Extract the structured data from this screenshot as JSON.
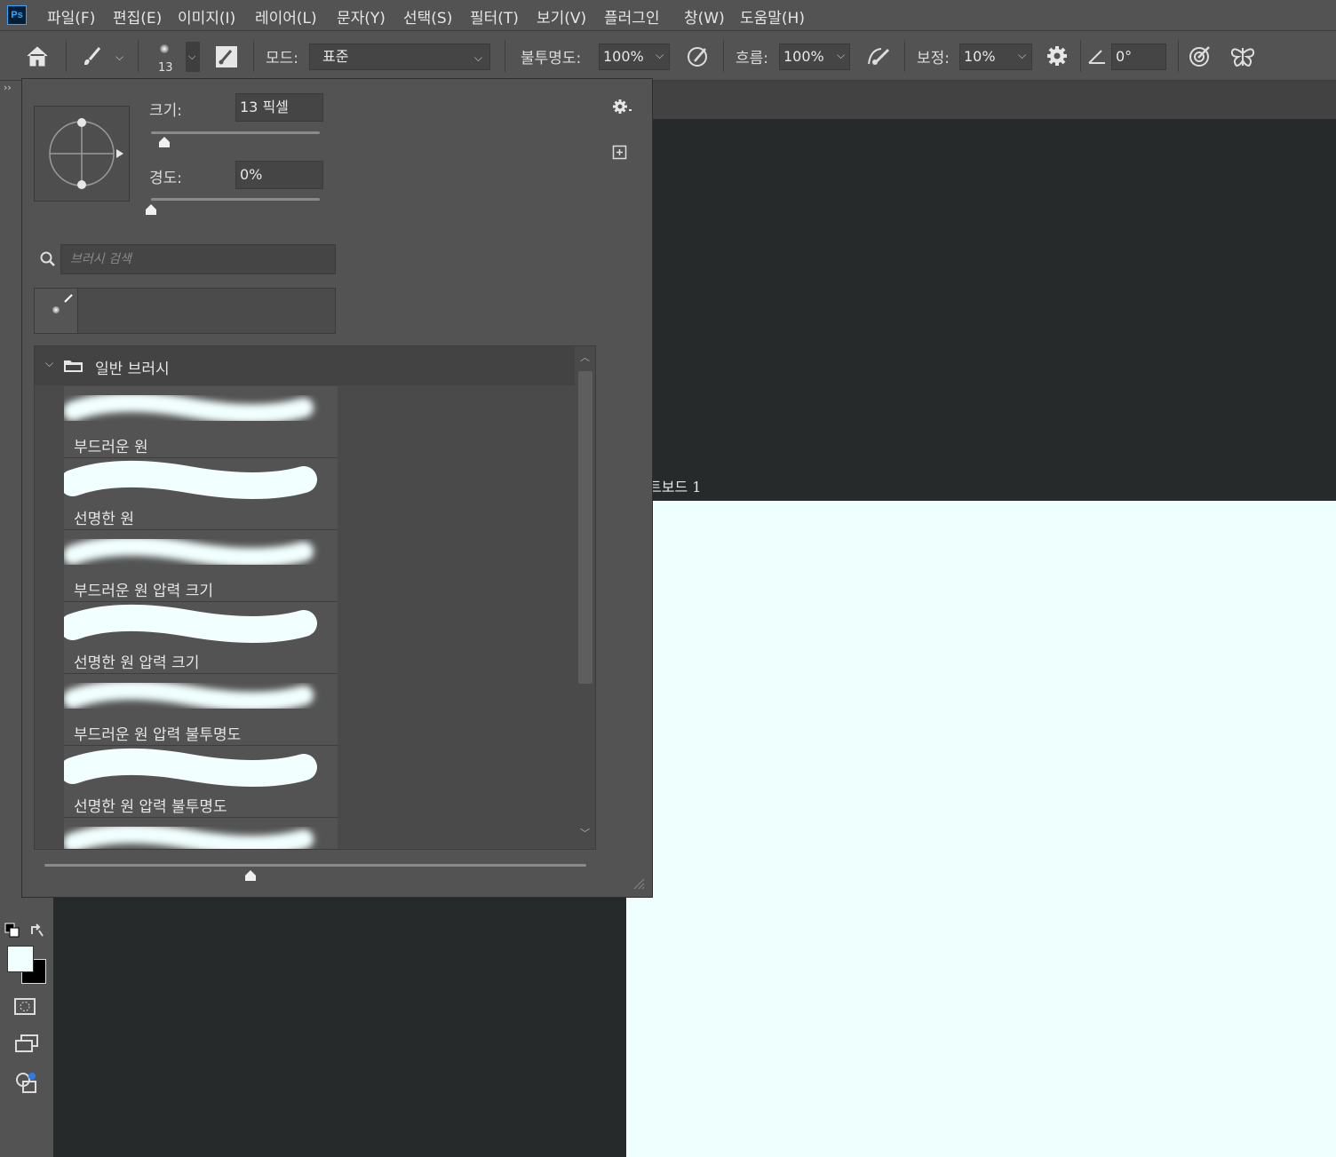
{
  "app": {
    "logo": "Ps"
  },
  "menu": [
    "파일(F)",
    "편집(E)",
    "이미지(I)",
    "레이어(L)",
    "문자(Y)",
    "선택(S)",
    "필터(T)",
    "보기(V)",
    "플러그인",
    "창(W)",
    "도움말(H)"
  ],
  "options": {
    "brush_size": "13",
    "mode_label": "모드:",
    "mode_value": "표준",
    "opacity_label": "불투명도:",
    "opacity_value": "100%",
    "flow_label": "흐름:",
    "flow_value": "100%",
    "smoothing_label": "보정:",
    "smoothing_value": "10%",
    "angle_value": "0°"
  },
  "panel": {
    "size_label": "크기:",
    "size_value": "13 픽셀",
    "size_fraction": 0.05,
    "hardness_label": "경도:",
    "hardness_value": "0%",
    "hardness_fraction": 0.0,
    "search_placeholder": "브러시 검색",
    "group_name": "일반 브러시",
    "preview_size_fraction": 0.38,
    "brushes": [
      {
        "name": "부드러운 원",
        "type": "soft"
      },
      {
        "name": "선명한 원",
        "type": "hard"
      },
      {
        "name": "부드러운 원 압력 크기",
        "type": "soft"
      },
      {
        "name": "선명한 원 압력 크기",
        "type": "hard"
      },
      {
        "name": "부드러운 원 압력 불투명도",
        "type": "soft"
      },
      {
        "name": "선명한 원 압력 불투명도",
        "type": "hard"
      },
      {
        "name": "",
        "type": "soft"
      }
    ]
  },
  "canvas": {
    "artboard_label": "트보드 1",
    "artboard_color": "#effffe"
  },
  "icons": {
    "home": "home-icon",
    "brush": "brush-icon",
    "settings": "gear-icon",
    "search": "search-icon",
    "folder": "folder-icon"
  }
}
